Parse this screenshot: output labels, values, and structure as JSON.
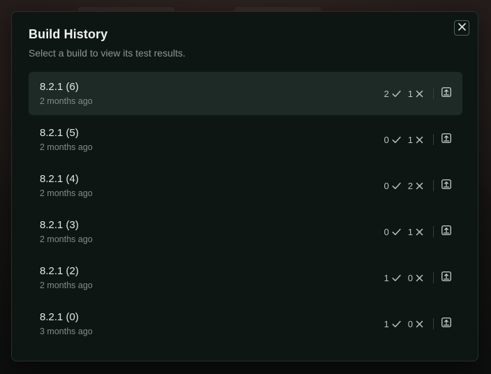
{
  "dialog": {
    "title": "Build History",
    "subtitle": "Select a build to view its test results."
  },
  "builds": [
    {
      "name": "8.2.1 (6)",
      "time": "2 months ago",
      "passed": "2",
      "failed": "1",
      "selected": true
    },
    {
      "name": "8.2.1 (5)",
      "time": "2 months ago",
      "passed": "0",
      "failed": "1",
      "selected": false
    },
    {
      "name": "8.2.1 (4)",
      "time": "2 months ago",
      "passed": "0",
      "failed": "2",
      "selected": false
    },
    {
      "name": "8.2.1 (3)",
      "time": "2 months ago",
      "passed": "0",
      "failed": "1",
      "selected": false
    },
    {
      "name": "8.2.1 (2)",
      "time": "2 months ago",
      "passed": "1",
      "failed": "0",
      "selected": false
    },
    {
      "name": "8.2.1 (0)",
      "time": "3 months ago",
      "passed": "1",
      "failed": "0",
      "selected": false
    }
  ],
  "icons": {
    "close": "close-icon",
    "passed": "check-icon",
    "failed": "x-icon",
    "open": "upload-box-icon"
  },
  "colors": {
    "dialog_background": "#0e1614",
    "selected_row": "#1d2a26",
    "accent_border": "#4b6660"
  }
}
